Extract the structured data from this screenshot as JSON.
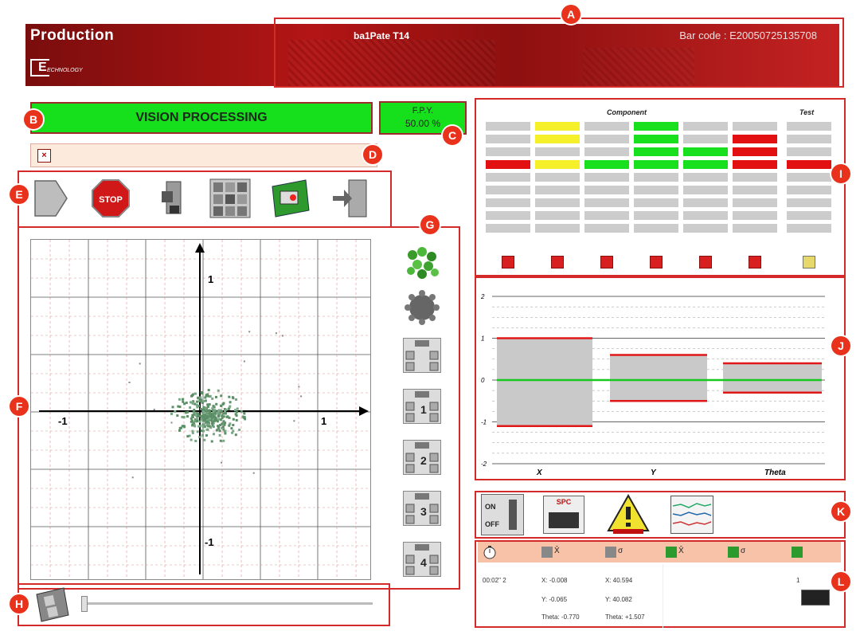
{
  "header": {
    "title": "Production",
    "part": "ba1Pate T14",
    "barcode": "Bar code : E20050725135708",
    "logo_letter": "E",
    "logo_text": "ECHNOLOGY"
  },
  "status": {
    "label": "VISION PROCESSING",
    "color": "#16e01c"
  },
  "fpy": {
    "label": "F.P.Y.",
    "value": "50.00 %"
  },
  "callouts": [
    "A",
    "B",
    "C",
    "D",
    "E",
    "E",
    "F",
    "G",
    "H",
    "I",
    "J",
    "K",
    "L"
  ],
  "toolbar": {
    "icons": [
      "play-icon",
      "stop-icon",
      "camera-icon",
      "image-grid-icon",
      "board-icon",
      "exit-door-icon"
    ],
    "stop_label": "STOP"
  },
  "scatter": {
    "x_pos_label": "1",
    "x_neg_label": "-1",
    "y_pos_label": "1",
    "y_neg_label": "-1"
  },
  "side_buttons": [
    "components-green-icon",
    "component-gray-icon",
    "camera-all-icon",
    "camera-1-icon",
    "camera-2-icon",
    "camera-3-icon",
    "camera-4-icon"
  ],
  "side_numbers": [
    "",
    "1",
    "2",
    "3",
    "4"
  ],
  "component_grid": {
    "header_component": "Component",
    "header_test": "Test",
    "rows": [
      [
        "gray",
        "yellow",
        "gray",
        "green",
        "gray",
        "gray",
        "gray"
      ],
      [
        "gray",
        "yellow",
        "gray",
        "green",
        "gray",
        "red",
        "gray"
      ],
      [
        "gray",
        "gray",
        "gray",
        "green",
        "green",
        "red",
        "gray"
      ],
      [
        "red",
        "yellow",
        "green",
        "green",
        "green",
        "red",
        "red"
      ],
      [
        "gray",
        "gray",
        "gray",
        "gray",
        "gray",
        "gray",
        "gray"
      ],
      [
        "gray",
        "gray",
        "gray",
        "gray",
        "gray",
        "gray",
        "gray"
      ],
      [
        "gray",
        "gray",
        "gray",
        "gray",
        "gray",
        "gray",
        "gray"
      ],
      [
        "gray",
        "gray",
        "gray",
        "gray",
        "gray",
        "gray",
        "gray"
      ],
      [
        "gray",
        "gray",
        "gray",
        "gray",
        "gray",
        "gray",
        "gray"
      ]
    ],
    "colors": {
      "gray": "#cccccc",
      "yellow": "#f6f02a",
      "green": "#18e01e",
      "red": "#e21010"
    }
  },
  "tol_chart": {
    "y_ticks": [
      "2",
      "1",
      "0",
      "-1",
      "-2"
    ],
    "categories": [
      "X",
      "Y",
      "Theta"
    ]
  },
  "chart_data": {
    "type": "bar",
    "categories": [
      "X",
      "Y",
      "Theta"
    ],
    "ylim": [
      -2,
      2
    ],
    "series": [
      {
        "values": [
          1.0,
          0.6,
          0.4
        ]
      },
      {
        "values": [
          -1.1,
          -0.5,
          -0.3
        ]
      },
      {
        "values": [
          0.0,
          0.0,
          0.0
        ]
      }
    ]
  },
  "kpanel": {
    "spc_label": "SPC",
    "on_label": "ON",
    "off_label": "OFF"
  },
  "ltable": {
    "row1": [
      "00:02'' 2",
      "X: -0.008",
      "X: 40.594",
      "",
      "",
      "1"
    ],
    "row2": [
      "",
      "Y: -0.065",
      "Y: 40.082",
      "",
      "",
      ""
    ],
    "row3": [
      "",
      "Theta: -0.770",
      "Theta: +1.507",
      "",
      "",
      ""
    ],
    "header_labels": [
      "",
      "X̄",
      "σ",
      "X̄",
      "σ",
      ""
    ]
  }
}
